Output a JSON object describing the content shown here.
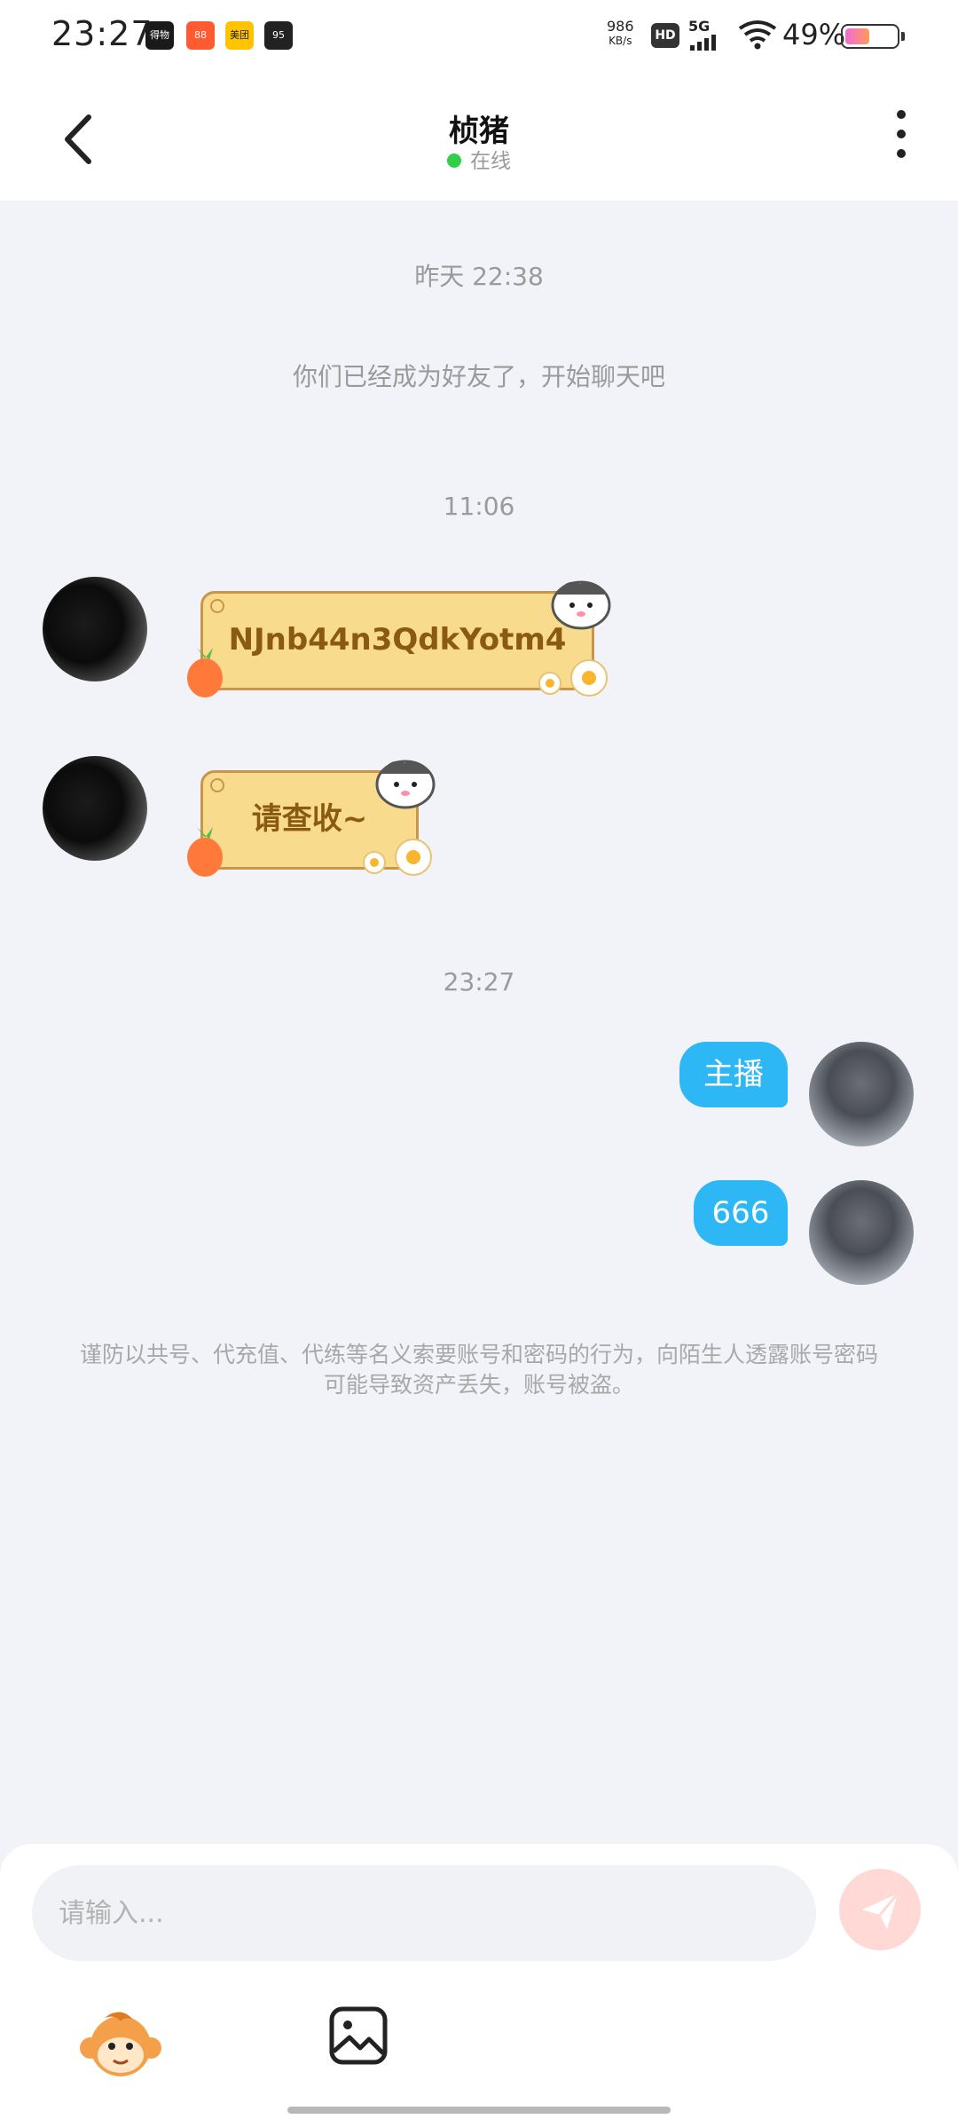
{
  "status_bar": {
    "time": "23:27",
    "apps": [
      {
        "label": "得物",
        "color": "#1a1a1a"
      },
      {
        "label": "88",
        "color": "#ff5b33"
      },
      {
        "label": "美团",
        "color": "#ffc300"
      },
      {
        "label": "95",
        "color": "#222222"
      }
    ],
    "net_speed_value": "986",
    "net_speed_unit": "KB/s",
    "hd_label": "HD",
    "network_label": "5G",
    "battery": "49%",
    "battery_level": 0.49
  },
  "header": {
    "title": "桢猪",
    "status": "在线"
  },
  "chat": {
    "time_1": "昨天 22:38",
    "system_message": "你们已经成为好友了，开始聊天吧",
    "time_2": "11:06",
    "friend_msg_1": "NJnb44n3QdkYotm4",
    "friend_msg_2": "请查收~",
    "time_3": "23:27",
    "my_msg_1": "主播",
    "my_msg_2": "666",
    "warning": "谨防以共号、代充值、代练等名义索要账号和密码的行为，向陌生人透露账号密码可能导致资产丢失，账号被盗。"
  },
  "input": {
    "placeholder": "请输入..."
  },
  "icons": {
    "back": "chevron-left-icon",
    "more": "more-vertical-icon",
    "send": "send-icon",
    "emoji": "monkey-emoji-icon",
    "image": "image-icon"
  },
  "colors": {
    "my_bubble": "#2db7f5",
    "note_bubble": "#f9db8e",
    "online": "#2fcf48",
    "send_button": "#ffd9d6"
  }
}
